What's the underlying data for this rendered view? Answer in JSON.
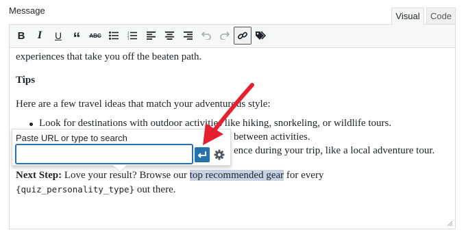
{
  "field_label": "Message",
  "tabs": [
    {
      "label": "Visual"
    },
    {
      "label": "Code"
    }
  ],
  "toolbar": {
    "buttons": [
      {
        "icon": "bold-icon"
      },
      {
        "icon": "italic-icon"
      },
      {
        "icon": "underline-icon"
      },
      {
        "icon": "blockquote-icon"
      },
      {
        "icon": "strikethrough-icon"
      },
      {
        "icon": "bulleted-list-icon"
      },
      {
        "icon": "numbered-list-icon"
      },
      {
        "icon": "align-left-icon"
      },
      {
        "icon": "align-center-icon"
      },
      {
        "icon": "align-right-icon"
      },
      {
        "icon": "undo-icon"
      },
      {
        "icon": "redo-icon"
      },
      {
        "icon": "link-icon",
        "active": true
      },
      {
        "icon": "tags-icon"
      }
    ]
  },
  "content": {
    "line1": "experiences that take you off the beaten path.",
    "heading": "Tips",
    "intro": "Here are a few travel ideas that match your adventurous style:",
    "bullet1": "Look for destinations with outdoor activities like hiking, snorkeling, or wildlife tours.",
    "bullet2_visible": "between activities.",
    "bullet3_visible": "ence during your trip, like a local adventure tour.",
    "next_step_label": "Next Step:",
    "next_step_text_before": "Love your result? Browse our",
    "next_step_link": "top recommended gear",
    "next_step_text_after": "for every",
    "merge_tag": "{quiz_personality_type}",
    "closing": "out there."
  },
  "link_popup": {
    "hint": "Paste URL or type to search",
    "url_value": "",
    "apply_icon": "enter-arrow-icon",
    "settings_icon": "gear-icon"
  },
  "colors": {
    "accent": "#2271b1",
    "highlight": "#c7d3e3",
    "annotation_arrow": "#e6202e"
  }
}
